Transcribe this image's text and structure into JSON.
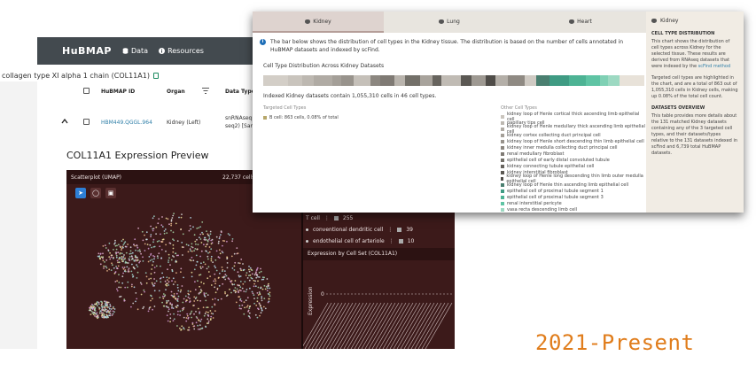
{
  "back": {
    "nav": {
      "logo": "HuBMAP",
      "data_label": "Data",
      "resources_label": "Resources"
    },
    "gene_title": "collagen type XI alpha 1 chain (COL11A1)",
    "table": {
      "headers": [
        "HuBMAP ID",
        "Organ",
        "Data Type"
      ],
      "row": {
        "id": "HBM449.QGGL.964",
        "organ": "Kidney (Left)",
        "data_type_line1": "snRNAseq",
        "data_type_line2": "seq2) [Sam"
      }
    },
    "preview_title": "COL11A1 Expression Preview",
    "scatter_title": "Scatterplot (UMAP)",
    "scatter_count": "22,737 cells",
    "cell_sets": [
      {
        "label": "T cell",
        "count": "255"
      },
      {
        "label": "conventional dendritic cell",
        "count": "39"
      },
      {
        "label": "endothelial cell of arteriole",
        "count": "10"
      }
    ],
    "expr_title": "Expression by Cell Set (COL11A1)",
    "expr_ylabel": "Expression",
    "expr_tick": "0"
  },
  "front": {
    "tabs": [
      {
        "label": "Kidney",
        "active": true
      },
      {
        "label": "Lung",
        "active": false
      },
      {
        "label": "Heart",
        "active": false
      }
    ],
    "info_text": "The bar below shows the distribution of cell types in the Kidney tissue. The distribution is based on the number of cells annotated in HuBMAP datasets and indexed by scFind.",
    "dist_label": "Cell Type Distribution Across Kidney Datasets",
    "indexed_text": "Indexed Kidney datasets contain 1,055,310 cells in 46 cell types.",
    "targeted_header": "Targeted Cell Types",
    "targeted_items": [
      {
        "label": "B cell: 863 cells, 0.08% of total",
        "color": "#b7a76a"
      }
    ],
    "other_header": "Other Cell Types",
    "other_items": [
      {
        "label": "kidney loop of Henle cortical thick ascending limb epithelial cell",
        "color": "#c9c4bd"
      },
      {
        "label": "papillary tips cell",
        "color": "#bdb8b1"
      },
      {
        "label": "kidney loop of Henle medullary thick ascending limb epithelial cell",
        "color": "#b0aba4"
      },
      {
        "label": "kidney cortex collecting duct principal cell",
        "color": "#a49f98"
      },
      {
        "label": "kidney loop of Henle short descending thin limb epithelial cell",
        "color": "#98938c"
      },
      {
        "label": "kidney inner medulla collecting duct principal cell",
        "color": "#8c8780"
      },
      {
        "label": "renal medullary fibroblast",
        "color": "#7f7a74"
      },
      {
        "label": "epithelial cell of early distal convoluted tubule",
        "color": "#737069"
      },
      {
        "label": "kidney connecting tubule epithelial cell",
        "color": "#67645e"
      },
      {
        "label": "kidney interstitial fibroblast",
        "color": "#5b5853"
      },
      {
        "label": "kidney loop of Henle long descending thin limb outer medulla epithelial cell",
        "color": "#4f4c48"
      },
      {
        "label": "kidney loop of Henle thin ascending limb epithelial cell",
        "color": "#4a7f70"
      },
      {
        "label": "epithelial cell of proximal tubule segment 1",
        "color": "#3f9b83"
      },
      {
        "label": "epithelial cell of proximal tubule segment 3",
        "color": "#4db394"
      },
      {
        "label": "renal interstitial pericyte",
        "color": "#5fc4a4"
      },
      {
        "label": "vasa recta descending limb cell",
        "color": "#9dd9c2"
      }
    ],
    "side": {
      "title": "Kidney",
      "sec1": "CELL TYPE DISTRIBUTION",
      "p1a": "This chart shows the distribution of cell types across Kidney for the selected tissue. These results are derived from RNAseq datasets that were indexed by the",
      "p1_link": "scFind method",
      "p2": "Targeted cell types are highlighted in the chart, and are a total of 863 out of 1,055,310 cells in Kidney cells, making up 0.08% of the total cell count.",
      "sec2": "DATASETS OVERVIEW",
      "p3": "This table provides more details about the 131 matched Kidney datasets containing any of the 3 targeted cell types, and their datasets/types relative to the 131 datasets indexed in scFind and 6,739 total HuBMAP datasets."
    }
  },
  "caption": "2021-Present",
  "colors": {
    "accent": "#e07d1c",
    "nav_bg": "#434a4f",
    "vitessce_bg": "#3c1a1a"
  }
}
